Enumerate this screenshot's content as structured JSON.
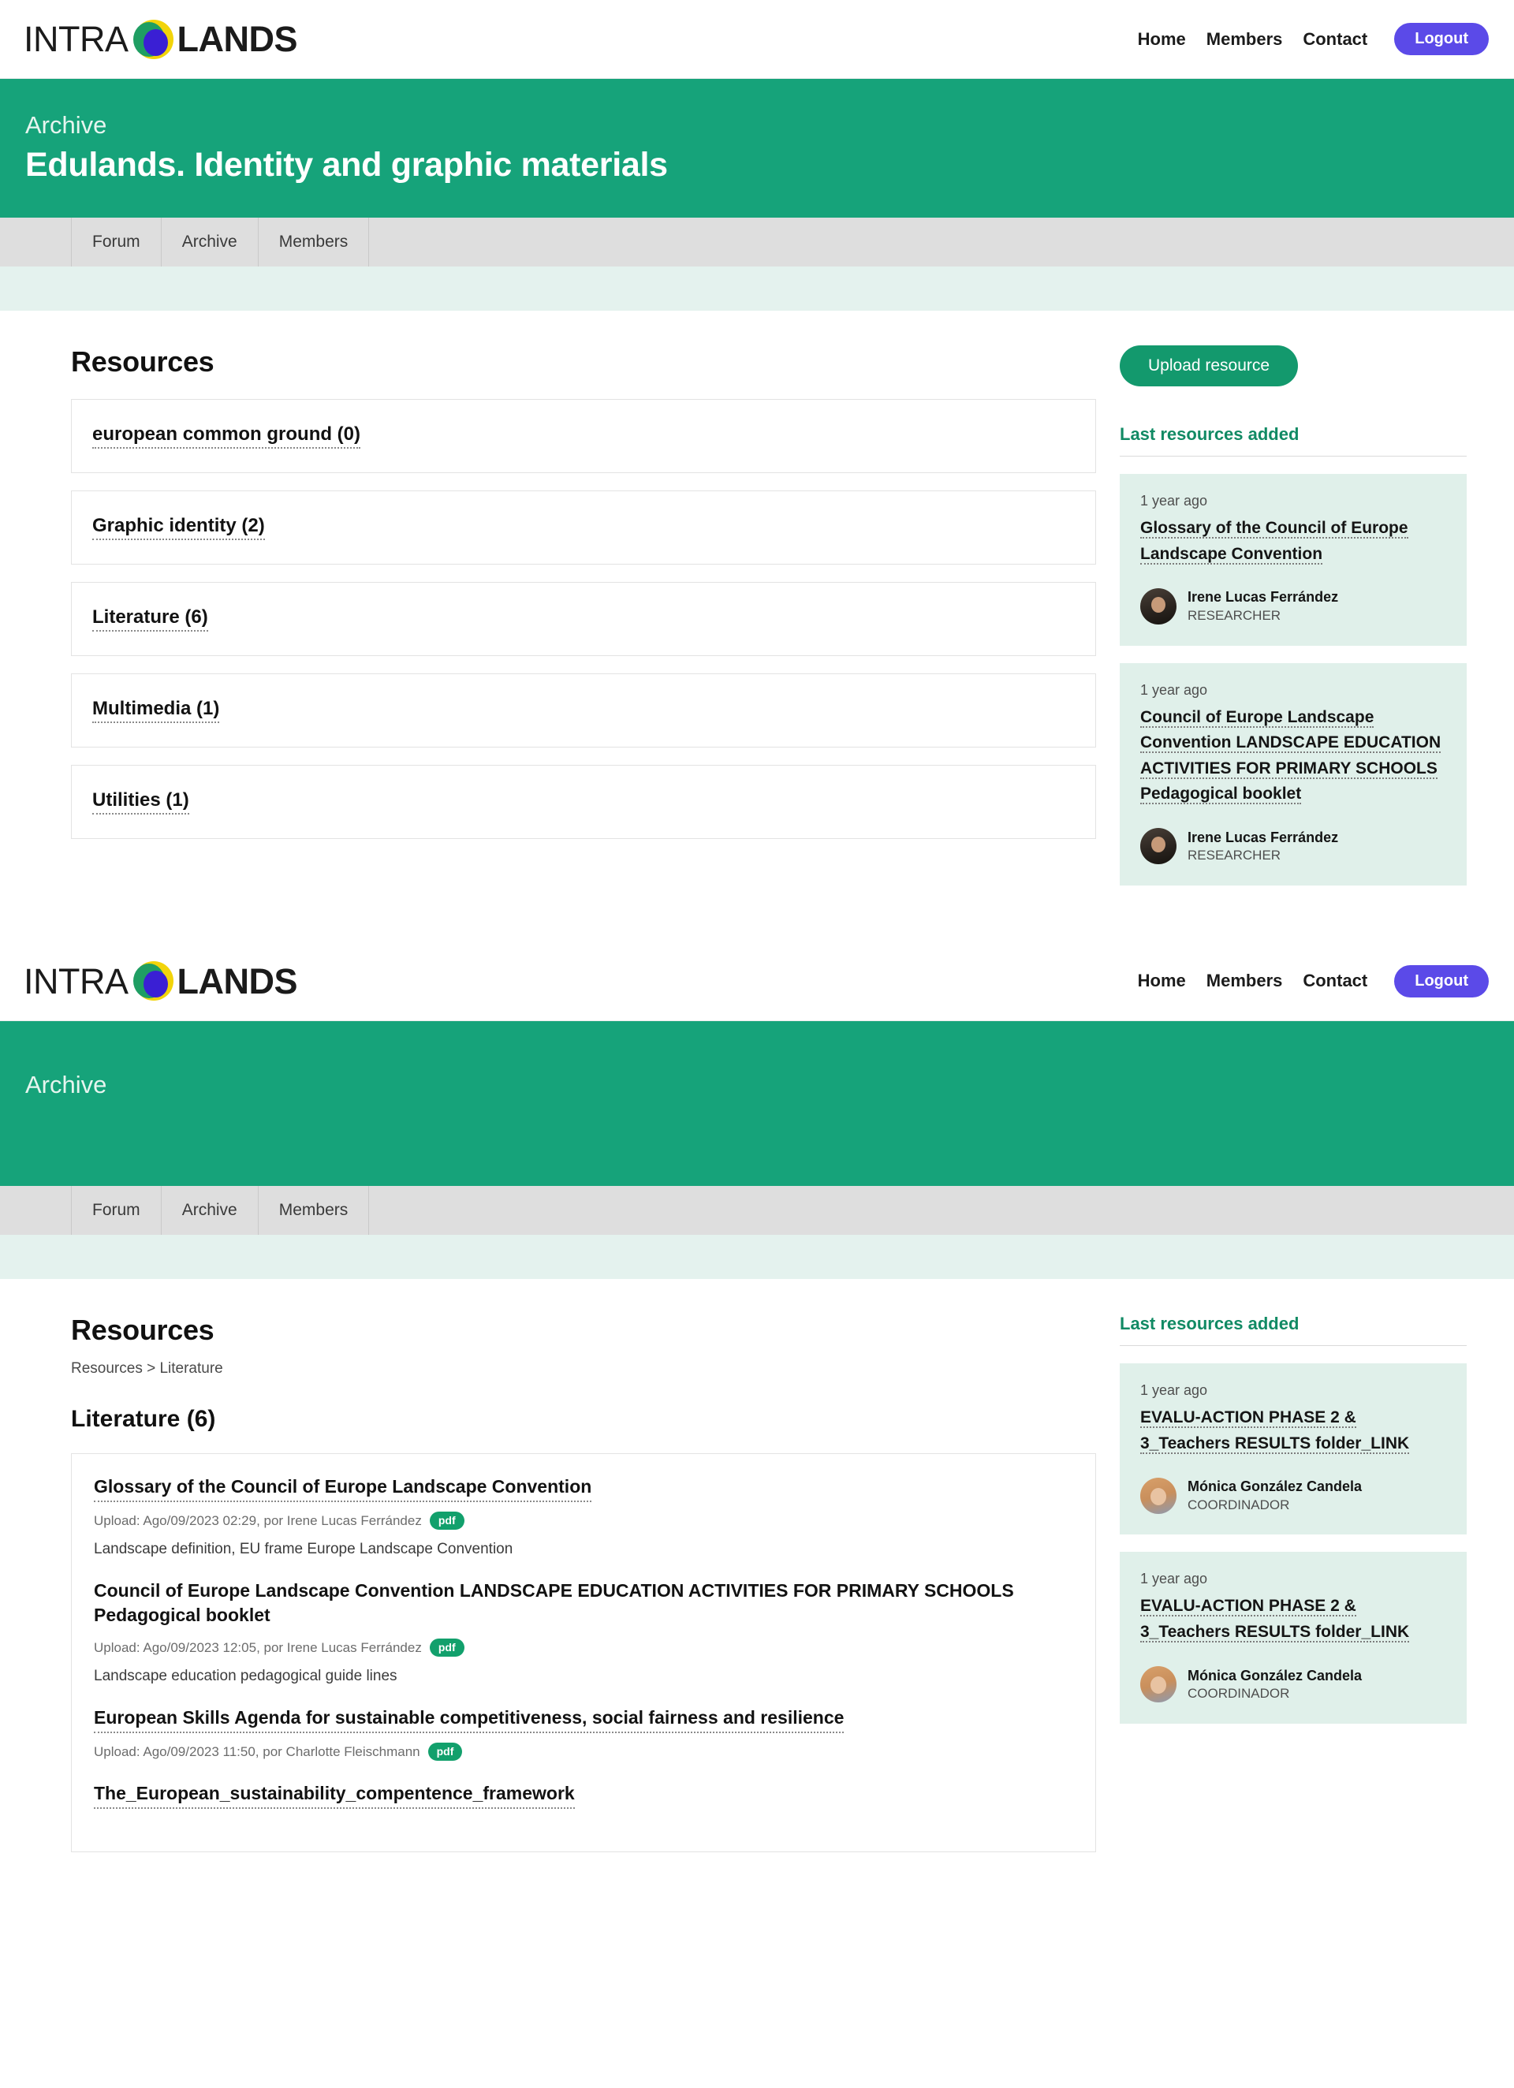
{
  "brand": {
    "name_light": "INTRA",
    "name_bold": "LANDS",
    "logo_icon": "intralands-blob-logo"
  },
  "nav": {
    "links": [
      "Home",
      "Members",
      "Contact"
    ],
    "logout_label": "Logout"
  },
  "tabs": [
    "Forum",
    "Archive",
    "Members"
  ],
  "colors": {
    "hero_green": "#16a37a",
    "accent_green": "#13996d",
    "logout_purple": "#5b4ae8",
    "side_card_bg": "#e0f0ea",
    "mint_strip": "#e4f2ee",
    "tabbar_grey": "#dedede",
    "pdf_badge": "#12a06c"
  },
  "view_one": {
    "hero": {
      "eyebrow": "Archive",
      "title": "Edulands. Identity and graphic materials"
    },
    "main": {
      "section_title": "Resources",
      "categories": [
        {
          "label": "european common ground (0)"
        },
        {
          "label": "Graphic identity (2)"
        },
        {
          "label": "Literature (6)"
        },
        {
          "label": "Multimedia (1)"
        },
        {
          "label": "Utilities (1)"
        }
      ]
    },
    "sidebar": {
      "upload_label": "Upload resource",
      "heading": "Last resources added",
      "cards": [
        {
          "time": "1 year ago",
          "title": "Glossary of the Council of Europe Landscape Convention",
          "user": "Irene Lucas Ferrández",
          "role": "RESEARCHER",
          "avatar": "irene"
        },
        {
          "time": "1 year ago",
          "title": "Council of Europe Landscape Convention LANDSCAPE EDUCATION ACTIVITIES FOR PRIMARY SCHOOLS Pedagogical booklet",
          "user": "Irene Lucas Ferrández",
          "role": "RESEARCHER",
          "avatar": "irene"
        }
      ]
    }
  },
  "view_two": {
    "hero": {
      "eyebrow": "Archive",
      "title": ""
    },
    "main": {
      "section_title": "Resources",
      "breadcrumb": "Resources > Literature",
      "subsection_title": "Literature (6)",
      "resources": [
        {
          "title": "Glossary of the Council of Europe Landscape Convention",
          "linked": true,
          "meta": "Upload: Ago/09/2023 02:29, por Irene Lucas Ferrández",
          "filetype": "pdf",
          "description": "Landscape definition, EU frame Europe Landscape Convention"
        },
        {
          "title": "Council of Europe Landscape Convention LANDSCAPE EDUCATION ACTIVITIES FOR PRIMARY SCHOOLS Pedagogical booklet",
          "linked": false,
          "meta": "Upload: Ago/09/2023 12:05, por Irene Lucas Ferrández",
          "filetype": "pdf",
          "description": "Landscape education pedagogical guide lines"
        },
        {
          "title": "European Skills Agenda for sustainable competitiveness, social fairness and resilience",
          "linked": true,
          "meta": "Upload: Ago/09/2023 11:50, por Charlotte Fleischmann",
          "filetype": "pdf",
          "description": ""
        },
        {
          "title": "The_European_sustainability_compentence_framework",
          "linked": true,
          "meta": "",
          "filetype": "",
          "description": ""
        }
      ]
    },
    "sidebar": {
      "heading": "Last resources added",
      "cards": [
        {
          "time": "1 year ago",
          "title": "EVALU-ACTION PHASE 2 & 3_Teachers RESULTS folder_LINK",
          "user": "Mónica González Candela",
          "role": "COORDINADOR",
          "avatar": "monica"
        },
        {
          "time": "1 year ago",
          "title": "EVALU-ACTION PHASE 2 & 3_Teachers RESULTS folder_LINK",
          "user": "Mónica González Candela",
          "role": "COORDINADOR",
          "avatar": "monica"
        }
      ]
    }
  }
}
